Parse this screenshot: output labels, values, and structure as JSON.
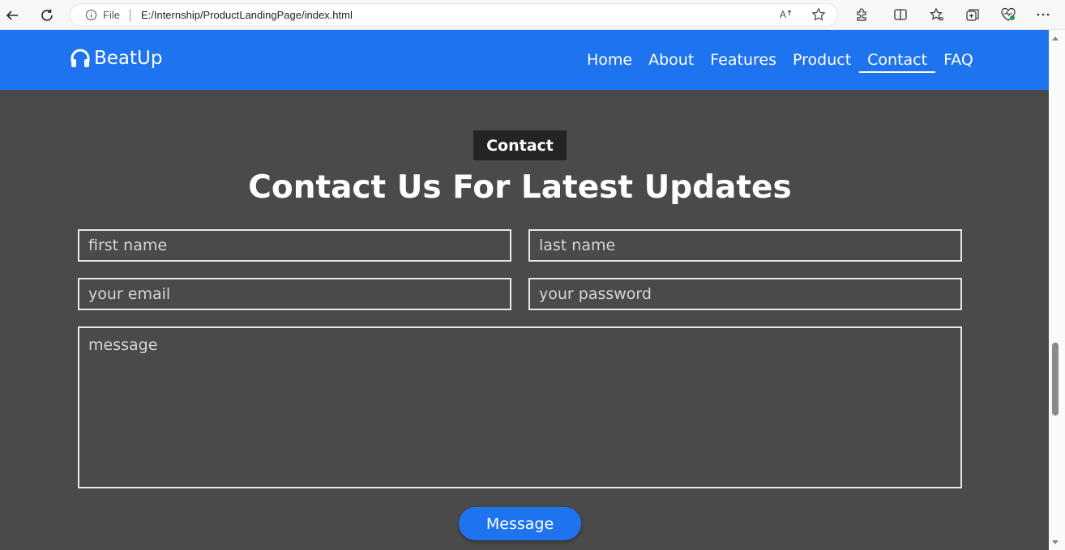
{
  "browser": {
    "file_label": "File",
    "url": "E:/Internship/ProductLandingPage/index.html",
    "icons": [
      "back-icon",
      "refresh-icon",
      "info-icon",
      "read-aloud-icon",
      "favorite-star-icon",
      "extensions-icon",
      "split-screen-icon",
      "favorites-icon",
      "collections-icon",
      "browser-essentials-icon",
      "more-icon"
    ]
  },
  "navbar": {
    "brand": "BeatUp",
    "brand_icon": "headphones-icon",
    "links": [
      "Home",
      "About",
      "Features",
      "Product",
      "Contact",
      "FAQ"
    ],
    "active_link": "Contact",
    "color": "#1e73ee"
  },
  "contact": {
    "tag": "Contact",
    "heading": "Contact Us For Latest Updates",
    "form": {
      "first_name_placeholder": "first name",
      "last_name_placeholder": "last name",
      "email_placeholder": "your email",
      "password_placeholder": "your password",
      "message_placeholder": "message",
      "submit_label": "Message"
    },
    "background": "#4a4a4a"
  }
}
